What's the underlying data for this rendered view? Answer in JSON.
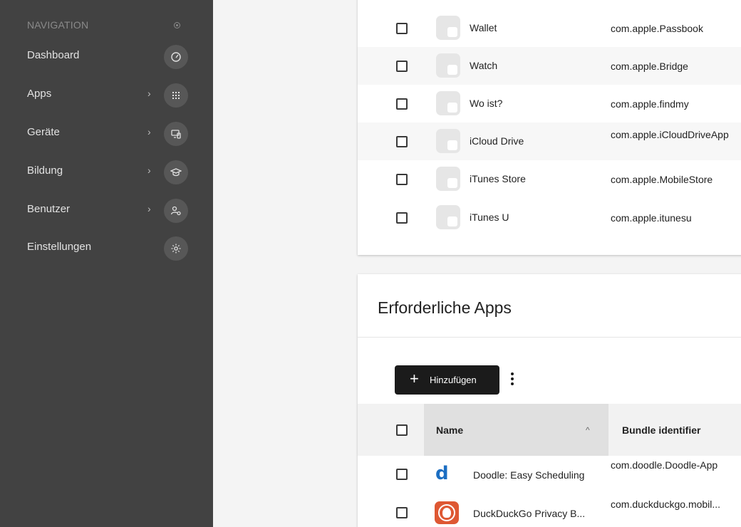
{
  "nav": {
    "header": "NAVIGATION",
    "items": [
      {
        "label": "Dashboard",
        "icon": "speedometer-icon",
        "chevron": ""
      },
      {
        "label": "Apps",
        "icon": "grid-icon",
        "chevron": "›"
      },
      {
        "label": "Geräte",
        "icon": "devices-icon",
        "chevron": "›"
      },
      {
        "label": "Bildung",
        "icon": "graduation-cap-icon",
        "chevron": "›"
      },
      {
        "label": "Benutzer",
        "icon": "user-gear-icon",
        "chevron": "›"
      },
      {
        "label": "Einstellungen",
        "icon": "gear-icon",
        "chevron": ""
      }
    ]
  },
  "optional_apps": {
    "rows": [
      {
        "name": "Wallet",
        "bundle": "com.apple.Passbook"
      },
      {
        "name": "Watch",
        "bundle": "com.apple.Bridge"
      },
      {
        "name": "Wo ist?",
        "bundle": "com.apple.findmy"
      },
      {
        "name": "iCloud Drive",
        "bundle": "com.apple.iCloudDriveApp"
      },
      {
        "name": "iTunes Store",
        "bundle": "com.apple.MobileStore"
      },
      {
        "name": "iTunes U",
        "bundle": "com.apple.itunesu"
      }
    ]
  },
  "required_apps": {
    "title": "Erforderliche Apps",
    "add_label": "Hinzufügen",
    "add_icon": "+",
    "columns": {
      "name": "Name",
      "bundle": "Bundle identifier"
    },
    "sort_indicator": "^",
    "rows": [
      {
        "name": "Doodle: Easy Scheduling",
        "bundle": "com.doodle.Doodle-App",
        "icon_letter": "d"
      },
      {
        "name": "DuckDuckGo Privacy B...",
        "bundle": "com.duckduckgo.mobil..."
      }
    ]
  },
  "colors": {
    "sidebar": "#424242",
    "button_dark": "#1b1b1b",
    "doodle_blue": "#1b6ec2",
    "ddg_orange": "#de5833"
  }
}
